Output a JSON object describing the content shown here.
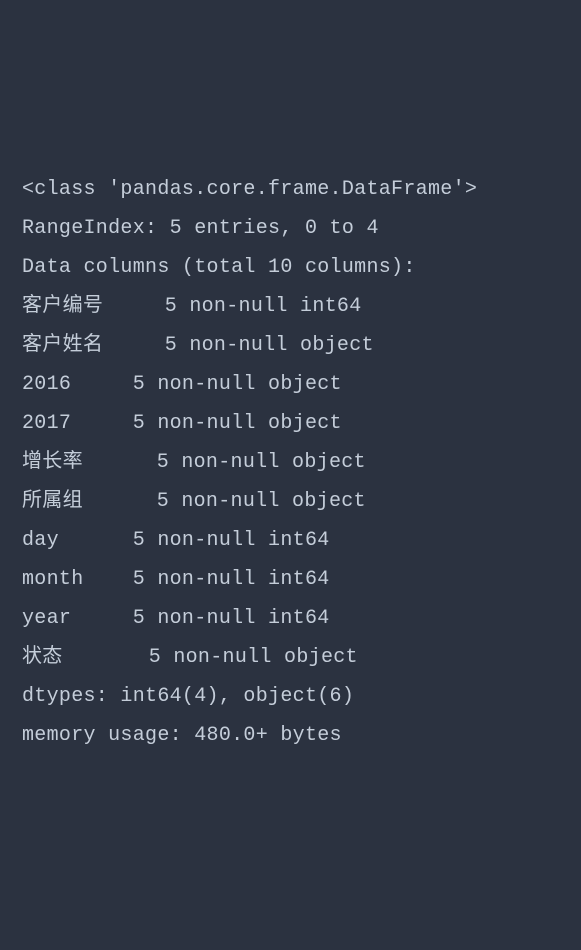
{
  "lines": {
    "l0": "<class 'pandas.core.frame.DataFrame'>",
    "l1": "RangeIndex: 5 entries, 0 to 4",
    "l2": "Data columns (total 10 columns):",
    "l3": "客户编号     5 non-null int64",
    "l4": "客户姓名     5 non-null object",
    "l5": "2016     5 non-null object",
    "l6": "2017     5 non-null object",
    "l7": "增长率      5 non-null object",
    "l8": "所属组      5 non-null object",
    "l9": "day      5 non-null int64",
    "l10": "month    5 non-null int64",
    "l11": "year     5 non-null int64",
    "l12": "状态       5 non-null object",
    "l13": "dtypes: int64(4), object(6)",
    "l14": "memory usage: 480.0+ bytes"
  }
}
